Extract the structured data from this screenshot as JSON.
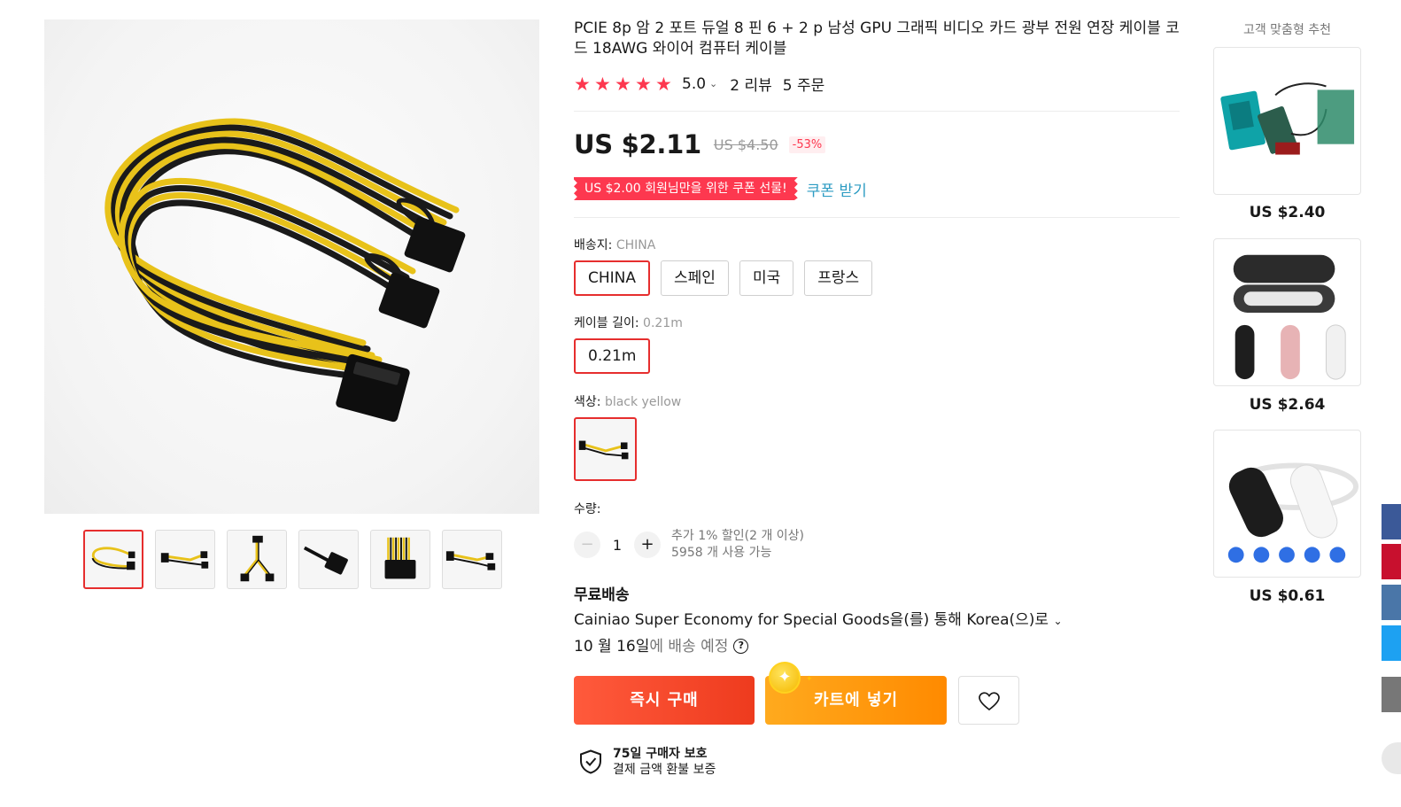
{
  "product": {
    "title": "PCIE 8p 암 2 포트 듀얼 8 핀 6 + 2 p 남성 GPU 그래픽 비디오 카드 광부 전원 연장 케이블 코드 18AWG 와이어 컴퓨터 케이블",
    "rating": "5.0",
    "stars": [
      "★",
      "★",
      "★",
      "★",
      "★"
    ],
    "reviews": "2 리뷰",
    "orders": "5 주문"
  },
  "price": {
    "current": "US $2.11",
    "original": "US $4.50",
    "discount": "-53%"
  },
  "coupon": {
    "badge": "US $2.00 회원님만을 위한 쿠폰 선물!",
    "link": "쿠폰 받기"
  },
  "shipping_from": {
    "label": "배송지: ",
    "value": "CHINA",
    "options": [
      "CHINA",
      "스페인",
      "미국",
      "프랑스"
    ],
    "selected_index": 0
  },
  "cable_length": {
    "label": "케이블 길이: ",
    "value": "0.21m",
    "options": [
      "0.21m"
    ]
  },
  "color": {
    "label": "색상: ",
    "value": "black yellow"
  },
  "quantity": {
    "label": "수량:",
    "minus": "−",
    "plus": "+",
    "value": "1",
    "note_discount": "추가 1% 할인(2 개 이상)",
    "note_stock": "5958 개 사용 가능"
  },
  "delivery": {
    "title": "무료배송",
    "method": "Cainiao Super Economy for Special Goods을(를) 통해 Korea(으)로",
    "caret": "⌄",
    "date": "10 월 16일",
    "date_suffix": "에 배송 예정",
    "help": "?"
  },
  "actions": {
    "buy": "즉시 구매",
    "cart": "카트에 넣기",
    "coin": "✦",
    "spark": "✦"
  },
  "protection": {
    "title": "75일 구매자 보호",
    "subtitle": "결제 금액 환불 보증"
  },
  "recommendations": {
    "title": "고객 맞춤형 추천",
    "items": [
      {
        "price": "US $2.40",
        "icon": "circuit-board-kit"
      },
      {
        "price": "US $2.64",
        "icon": "earphone-case"
      },
      {
        "price": "US $0.61",
        "icon": "bluetooth-headset"
      }
    ]
  },
  "colors": {
    "accent_red": "#fd384f",
    "selected_border": "#e62e2e",
    "link_blue": "#2e9cc3",
    "buy_orange": "#ee3b1e",
    "cart_orange": "#ff8a00",
    "side_blue": "#3b5998",
    "side_red": "#c8102e",
    "side_steel": "#4a76a8",
    "side_cyan": "#1da1f2",
    "side_gray": "#777777"
  }
}
